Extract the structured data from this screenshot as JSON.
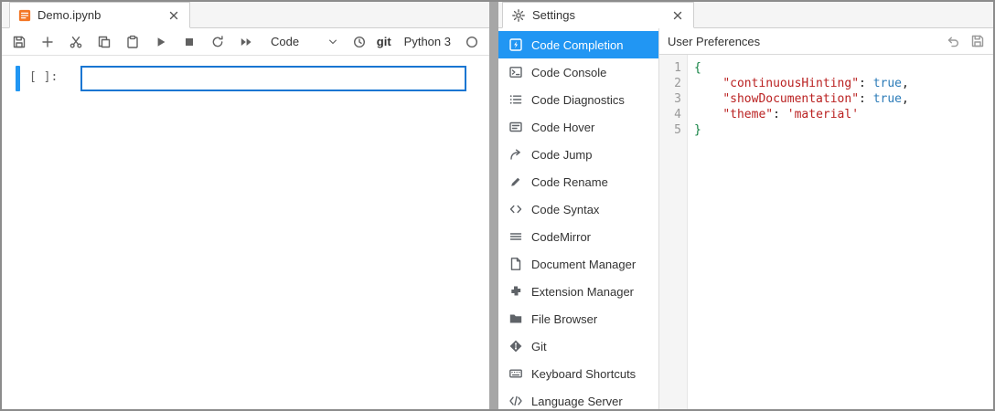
{
  "colors": {
    "accent": "#1976d2",
    "cell_bar": "#2196f3",
    "selection": "#2196f3",
    "icon_gray": "#616161",
    "notebook_orange": "#f37726",
    "token_key": "#ba2121",
    "token_string": "#ba2121",
    "token_atom": "#2b7bb8",
    "token_brace": "#108040"
  },
  "notebook_panel": {
    "tab_title": "Demo.ipynb",
    "cell_prompt": "[ ]:",
    "toolbar": {
      "cell_type": "Code",
      "git_label": "git",
      "kernel_name": "Python 3",
      "buttons": [
        {
          "name": "save",
          "icon": "save"
        },
        {
          "name": "insert-cell-below",
          "icon": "plus"
        },
        {
          "name": "cut-cells",
          "icon": "cut"
        },
        {
          "name": "copy-cells",
          "icon": "copy"
        },
        {
          "name": "paste-cells",
          "icon": "paste"
        },
        {
          "name": "run-cell",
          "icon": "run"
        },
        {
          "name": "interrupt-kernel",
          "icon": "stop"
        },
        {
          "name": "restart-kernel",
          "icon": "restart"
        },
        {
          "name": "restart-run-all",
          "icon": "fast-forward"
        }
      ]
    }
  },
  "settings_panel": {
    "tab_title": "Settings",
    "plugins": [
      {
        "label": "Code Completion",
        "icon": "completion",
        "selected": true
      },
      {
        "label": "Code Console",
        "icon": "console",
        "selected": false
      },
      {
        "label": "Code Diagnostics",
        "icon": "diagnostics",
        "selected": false
      },
      {
        "label": "Code Hover",
        "icon": "hover",
        "selected": false
      },
      {
        "label": "Code Jump",
        "icon": "jump",
        "selected": false
      },
      {
        "label": "Code Rename",
        "icon": "rename",
        "selected": false
      },
      {
        "label": "Code Syntax",
        "icon": "syntax",
        "selected": false
      },
      {
        "label": "CodeMirror",
        "icon": "codemirror",
        "selected": false
      },
      {
        "label": "Document Manager",
        "icon": "document",
        "selected": false
      },
      {
        "label": "Extension Manager",
        "icon": "extension",
        "selected": false
      },
      {
        "label": "File Browser",
        "icon": "folder",
        "selected": false
      },
      {
        "label": "Git",
        "icon": "git",
        "selected": false
      },
      {
        "label": "Keyboard Shortcuts",
        "icon": "keyboard",
        "selected": false
      },
      {
        "label": "Language Server",
        "icon": "language",
        "selected": false
      }
    ],
    "editor": {
      "title": "User Preferences",
      "lines": [
        {
          "num": "1",
          "tokens": [
            {
              "t": "{",
              "c": "brace"
            }
          ]
        },
        {
          "num": "2",
          "tokens": [
            {
              "t": "    ",
              "c": "plain"
            },
            {
              "t": "\"continuousHinting\"",
              "c": "key"
            },
            {
              "t": ": ",
              "c": "plain"
            },
            {
              "t": "true",
              "c": "atom"
            },
            {
              "t": ",",
              "c": "plain"
            }
          ]
        },
        {
          "num": "3",
          "tokens": [
            {
              "t": "    ",
              "c": "plain"
            },
            {
              "t": "\"showDocumentation\"",
              "c": "key"
            },
            {
              "t": ": ",
              "c": "plain"
            },
            {
              "t": "true",
              "c": "atom"
            },
            {
              "t": ",",
              "c": "plain"
            }
          ]
        },
        {
          "num": "4",
          "tokens": [
            {
              "t": "    ",
              "c": "plain"
            },
            {
              "t": "\"theme\"",
              "c": "key"
            },
            {
              "t": ": ",
              "c": "plain"
            },
            {
              "t": "'material'",
              "c": "string"
            }
          ]
        },
        {
          "num": "5",
          "tokens": [
            {
              "t": "}",
              "c": "brace"
            }
          ]
        }
      ]
    }
  }
}
